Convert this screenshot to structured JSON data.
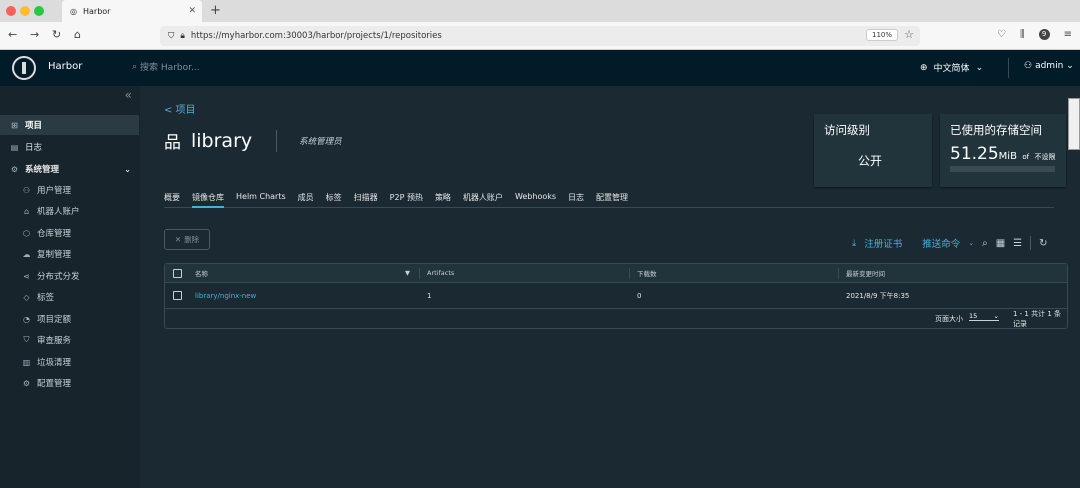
{
  "browser": {
    "tab_title": "Harbor",
    "url": "https://myharbor.com:30003/harbor/projects/1/repositories",
    "zoom": "110%",
    "badge": "9"
  },
  "header": {
    "brand": "Harbor",
    "search_placeholder": "搜索 Harbor...",
    "language": "中文简体",
    "user": "admin"
  },
  "sidebar": {
    "items": [
      {
        "label": "项目"
      },
      {
        "label": "日志"
      },
      {
        "label": "系统管理"
      },
      {
        "label": "用户管理"
      },
      {
        "label": "机器人账户"
      },
      {
        "label": "仓库管理"
      },
      {
        "label": "复制管理"
      },
      {
        "label": "分布式分发"
      },
      {
        "label": "标签"
      },
      {
        "label": "项目定额"
      },
      {
        "label": "审查服务"
      },
      {
        "label": "垃圾清理"
      },
      {
        "label": "配置管理"
      }
    ]
  },
  "main": {
    "back_label": "< 项目",
    "project_name": "library",
    "role": "系统管理员",
    "access_card": {
      "title": "访问级别",
      "value": "公开"
    },
    "storage_card": {
      "title": "已使用的存储空间",
      "value": "51.25",
      "unit": "MiB",
      "of": "of",
      "limit": "不设限"
    },
    "tabs": [
      "概要",
      "镜像仓库",
      "Helm Charts",
      "成员",
      "标签",
      "扫描器",
      "P2P 预热",
      "策略",
      "机器人账户",
      "Webhooks",
      "日志",
      "配置管理"
    ],
    "delete_label": "删除",
    "push_cert_label": "注册证书",
    "push_cmd_label": "推送命令",
    "table": {
      "columns": [
        "名称",
        "Artifacts",
        "下载数",
        "最新变更时间"
      ],
      "rows": [
        {
          "name": "library/nginx-new",
          "artifacts": "1",
          "pulls": "0",
          "updated": "2021/8/9 下午8:35"
        }
      ],
      "page_size_label": "页面大小",
      "page_size": "15",
      "summary": "1 - 1 共计 1 条记录"
    }
  },
  "colors": {
    "accent": "#4aaed9",
    "header_bg": "#021b28",
    "sidebar_bg": "#17242b",
    "content_bg": "#1b2a32"
  }
}
